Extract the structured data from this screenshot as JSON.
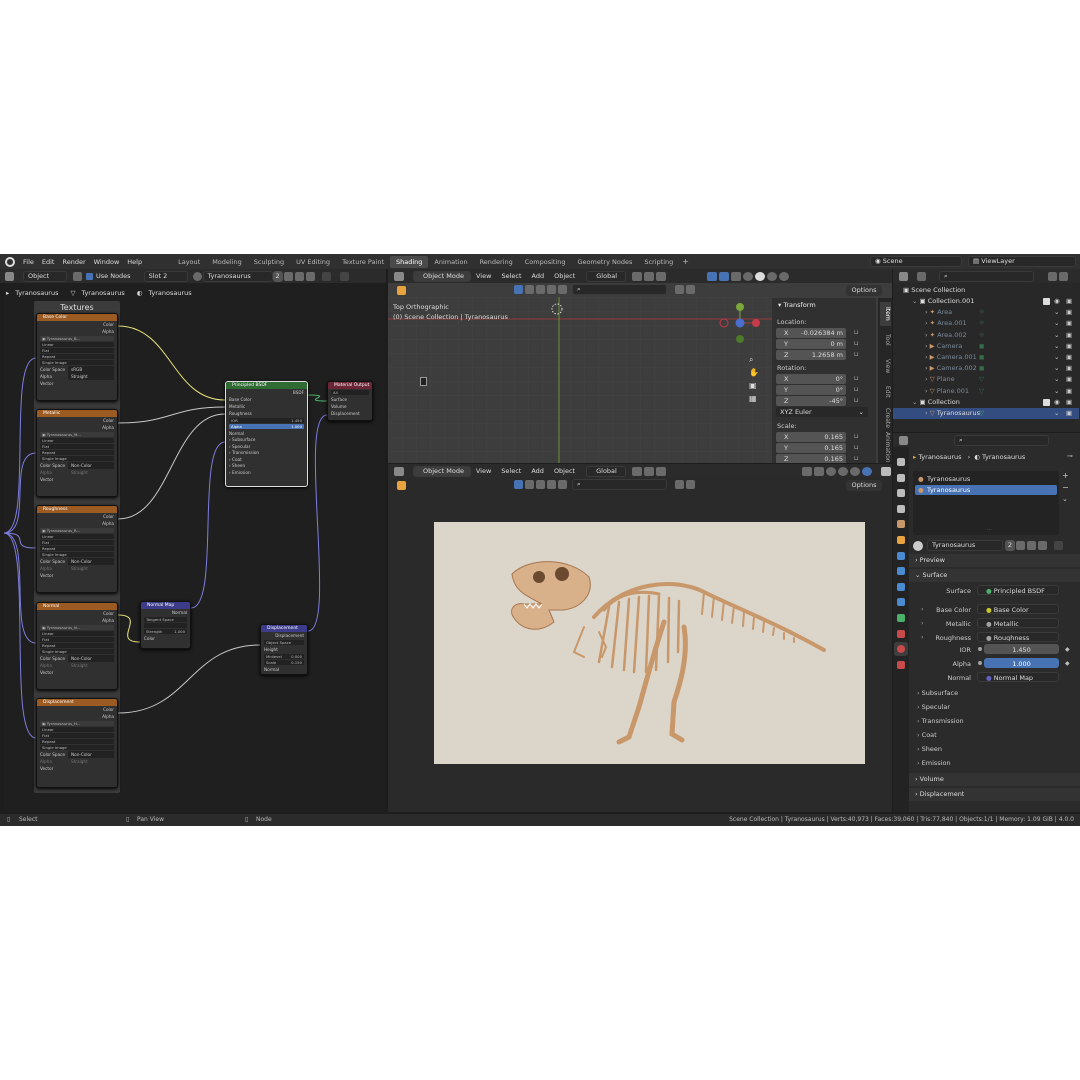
{
  "menus": [
    "File",
    "Edit",
    "Render",
    "Window",
    "Help"
  ],
  "workspaces": [
    "Layout",
    "Modeling",
    "Sculpting",
    "UV Editing",
    "Texture Paint",
    "Shading",
    "Animation",
    "Rendering",
    "Compositing",
    "Geometry Nodes",
    "Scripting"
  ],
  "active_workspace": "Shading",
  "scene": "Scene",
  "view_layer": "ViewLayer",
  "node_header": {
    "object": "Object",
    "use_nodes": "Use Nodes",
    "slot": "Slot 2",
    "material": "Tyranosaurus",
    "users": "2"
  },
  "breadcrumbs": [
    "Tyranosaurus",
    "Tyranosaurus",
    "Tyranosaurus"
  ],
  "frame_label": "Textures",
  "tex_nodes": [
    {
      "title": "Base Color",
      "image": "Tyranosaurus_B...",
      "colorspace": "sRGB",
      "alpha": "Straight"
    },
    {
      "title": "Metallic",
      "image": "Tyranosaurus_M...",
      "colorspace": "Non-Color",
      "alpha": "Straight"
    },
    {
      "title": "Roughness",
      "image": "Tyranosaurus_R...",
      "colorspace": "Non-Color",
      "alpha": "Straight"
    },
    {
      "title": "Normal",
      "image": "Tyranosaurus_N...",
      "colorspace": "Non-Color",
      "alpha": "Straight"
    },
    {
      "title": "Displacement",
      "image": "Tyranosaurus_H...",
      "colorspace": "Non-Color",
      "alpha": "Straight"
    }
  ],
  "tex_rows": {
    "color": "Color",
    "alpha": "Alpha",
    "linear": "Linear",
    "flat": "Flat",
    "repeat": "Repeat",
    "single": "Single Image",
    "colorspace": "Color Space",
    "alpha_label": "Alpha",
    "vector": "Vector"
  },
  "bsdf": {
    "title": "Principled BSDF",
    "out": "BSDF",
    "inputs": [
      "Base Color",
      "Metallic",
      "Roughness"
    ],
    "ior_label": "IOR",
    "ior": "1.450",
    "alpha_label": "Alpha",
    "alpha": "1.000",
    "normal": "Normal",
    "sections": [
      "Subsurface",
      "Specular",
      "Transmission",
      "Coat",
      "Sheen",
      "Emission"
    ]
  },
  "output_node": {
    "title": "Material Output",
    "target": "All",
    "inputs": [
      "Surface",
      "Volume",
      "Displacement"
    ]
  },
  "normal_map": {
    "title": "Normal Map",
    "out": "Normal",
    "space": "Tangent Space",
    "strength_label": "Strength",
    "strength": "1.000",
    "color": "Color"
  },
  "disp_node": {
    "title": "Displacement",
    "out": "Displacement",
    "space": "Object Space",
    "height": "Height",
    "midlevel_label": "Midlevel",
    "midlevel": "0.000",
    "scale_label": "Scale",
    "scale": "0.150",
    "normal": "Normal"
  },
  "viewport_header": {
    "mode": "Object Mode",
    "menus": [
      "View",
      "Select",
      "Add",
      "Object"
    ],
    "orientation": "Global",
    "options": "Options"
  },
  "top_view": {
    "title": "Top Orthographic",
    "subtitle": "(0) Scene Collection | Tyranosaurus"
  },
  "transform": {
    "title": "Transform",
    "location": "Location:",
    "loc": [
      {
        "a": "X",
        "v": "-0.026384 m"
      },
      {
        "a": "Y",
        "v": "0 m"
      },
      {
        "a": "Z",
        "v": "1.2658 m"
      }
    ],
    "rotation": "Rotation:",
    "rot": [
      {
        "a": "X",
        "v": "0°"
      },
      {
        "a": "Y",
        "v": "0°"
      },
      {
        "a": "Z",
        "v": "-45°"
      }
    ],
    "mode": "XYZ Euler",
    "scale": "Scale:",
    "scl": [
      {
        "a": "X",
        "v": "0.165"
      },
      {
        "a": "Y",
        "v": "0.165"
      },
      {
        "a": "Z",
        "v": "0.165"
      }
    ]
  },
  "side_tabs": [
    "Item",
    "Tool",
    "View",
    "Edit",
    "Create",
    "Animation"
  ],
  "outliner": {
    "root": "Scene Collection",
    "rows": [
      {
        "name": "Collection.001",
        "indent": 1,
        "kind": "coll"
      },
      {
        "name": "Area",
        "indent": 2,
        "kind": "light"
      },
      {
        "name": "Area.001",
        "indent": 2,
        "kind": "light"
      },
      {
        "name": "Area.002",
        "indent": 2,
        "kind": "light"
      },
      {
        "name": "Camera",
        "indent": 2,
        "kind": "cam"
      },
      {
        "name": "Camera.001",
        "indent": 2,
        "kind": "cam"
      },
      {
        "name": "Camera.002",
        "indent": 2,
        "kind": "cam"
      },
      {
        "name": "Plane",
        "indent": 2,
        "kind": "mesh"
      },
      {
        "name": "Plane.001",
        "indent": 2,
        "kind": "mesh"
      },
      {
        "name": "Collection",
        "indent": 1,
        "kind": "coll"
      },
      {
        "name": "Tyranosaurus",
        "indent": 2,
        "kind": "mesh",
        "selected": true
      }
    ]
  },
  "properties": {
    "object": "Tyranosaurus",
    "material": "Tyranosaurus",
    "slots": [
      "Tyranosaurus",
      "Tyranosaurus"
    ],
    "mat_field": "Tyranosaurus",
    "users": "2",
    "preview": "Preview",
    "surface_panel": "Surface",
    "surface_label": "Surface",
    "surface": "Principled BSDF",
    "inputs": [
      {
        "label": "Base Color",
        "value": "Base Color"
      },
      {
        "label": "Metallic",
        "value": "Metallic"
      },
      {
        "label": "Roughness",
        "value": "Roughness"
      }
    ],
    "ior_label": "IOR",
    "ior": "1.450",
    "alpha_label": "Alpha",
    "alpha": "1.000",
    "normal_label": "Normal",
    "normal": "Normal Map",
    "sections": [
      "Subsurface",
      "Specular",
      "Transmission",
      "Coat",
      "Sheen",
      "Emission"
    ],
    "volume": "Volume",
    "displacement": "Displacement"
  },
  "status": {
    "select": "Select",
    "pan": "Pan View",
    "node": "Node",
    "info": "Scene Collection | Tyranosaurus | Verts:40,973 | Faces:39,060 | Tris:77,840 | Objects:1/1 | Memory: 1.09 GiB | 4.0.0"
  },
  "colors": {
    "accent": "#4772b3",
    "texture_head": "#9b5b22",
    "shader_head": "#2f6b33",
    "output_head": "#6b2536",
    "vector_head": "#3c3c8a",
    "render_bg": "#dcd5ca",
    "bone": "#d8b08a"
  }
}
